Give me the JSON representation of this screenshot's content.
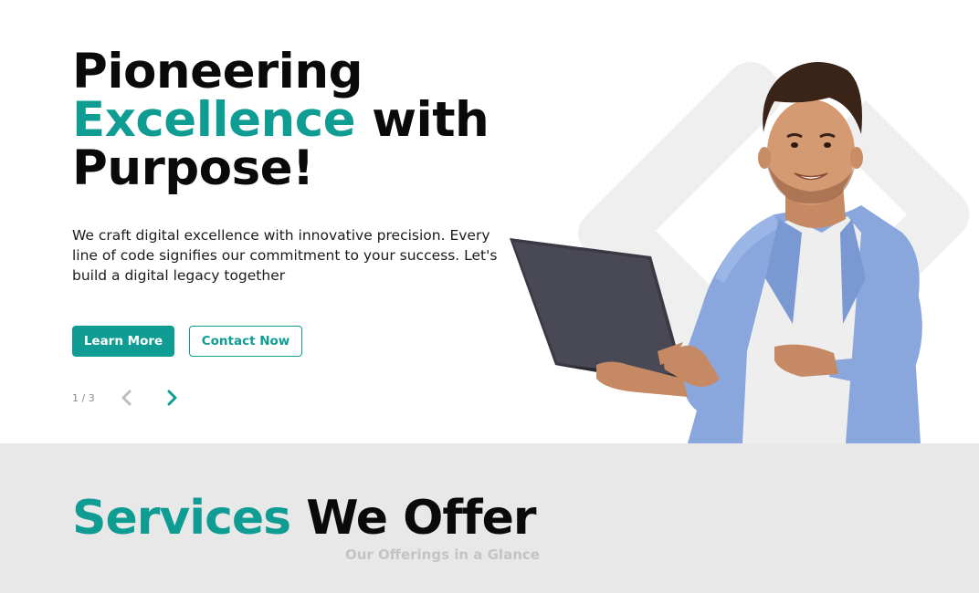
{
  "hero": {
    "headline": {
      "line1": "Pioneering",
      "accent": "Excellence",
      "after_accent": " with",
      "line3": "Purpose!"
    },
    "subtext": "We craft digital excellence with innovative precision. Every line of code signifies our commitment to your success. Let's build a digital legacy together",
    "buttons": {
      "primary_label": "Learn More",
      "secondary_label": "Contact Now"
    },
    "pager": {
      "current": 1,
      "total": 3,
      "label": "1 / 3"
    }
  },
  "services": {
    "title_accent": "Services",
    "title_rest": " We Offer",
    "subtitle": "Our Offerings in a Glance"
  },
  "icons": {
    "prev": "chevron-left-icon",
    "next": "chevron-right-icon"
  },
  "colors": {
    "accent": "#0e9c93",
    "text": "#0a0a0a",
    "section_bg": "#e8e8e8",
    "muted": "#c4c4c4"
  }
}
